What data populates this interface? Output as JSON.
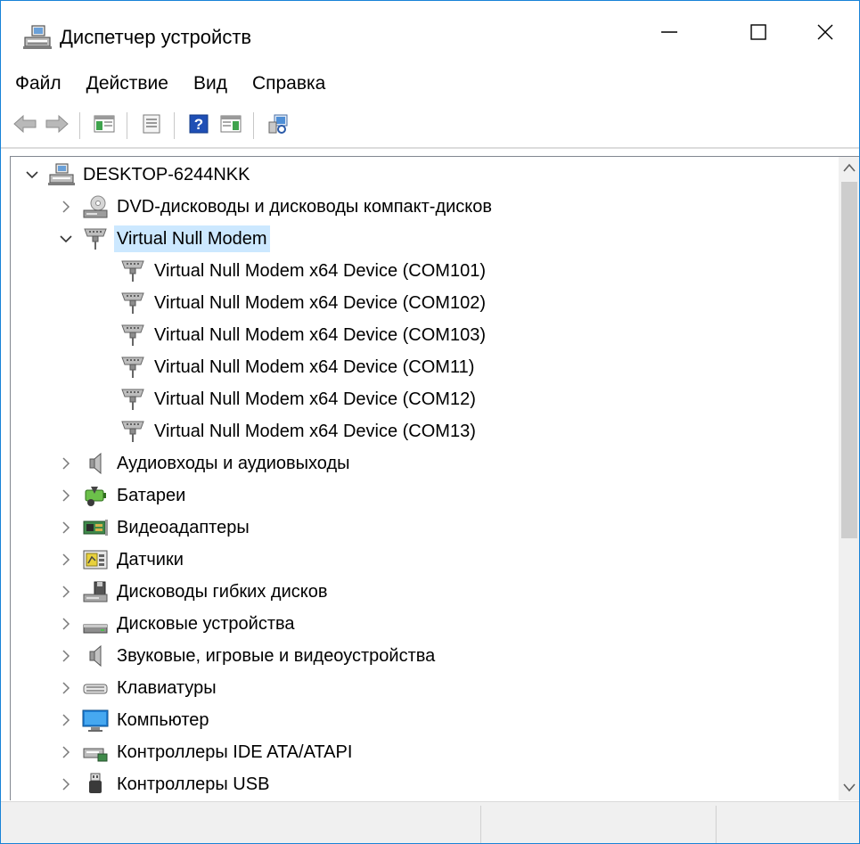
{
  "window": {
    "title": "Диспетчер устройств",
    "title_icon": "device-manager-icon",
    "controls": [
      "minimize-icon",
      "maximize-icon",
      "close-icon"
    ]
  },
  "menu": {
    "items": [
      "Файл",
      "Действие",
      "Вид",
      "Справка"
    ]
  },
  "toolbar": {
    "buttons": [
      "back-arrow-icon",
      "forward-arrow-icon",
      "console-tree-icon",
      "properties-icon",
      "help-icon",
      "action-pane-icon",
      "scan-hardware-icon"
    ]
  },
  "tree": {
    "root": {
      "label": "DESKTOP-6244NKK",
      "expanded": true,
      "icon": "computer-icon"
    },
    "items": [
      {
        "label": "DVD-дисководы и дисководы компакт-дисков",
        "expanded": false,
        "icon": "dvd-drive-icon"
      },
      {
        "label": "Virtual Null Modem",
        "expanded": true,
        "selected": true,
        "icon": "serial-port-icon",
        "children": [
          "Virtual Null Modem x64 Device (COM101)",
          "Virtual Null Modem x64 Device (COM102)",
          "Virtual Null Modem x64 Device (COM103)",
          "Virtual Null Modem x64 Device (COM11)",
          "Virtual Null Modem x64 Device (COM12)",
          "Virtual Null Modem x64 Device (COM13)"
        ]
      },
      {
        "label": "Аудиовходы и аудиовыходы",
        "expanded": false,
        "icon": "speaker-icon"
      },
      {
        "label": "Батареи",
        "expanded": false,
        "icon": "battery-icon"
      },
      {
        "label": "Видеоадаптеры",
        "expanded": false,
        "icon": "display-adapter-icon"
      },
      {
        "label": "Датчики",
        "expanded": false,
        "icon": "sensor-icon"
      },
      {
        "label": "Дисководы гибких дисков",
        "expanded": false,
        "icon": "floppy-drive-icon"
      },
      {
        "label": "Дисковые устройства",
        "expanded": false,
        "icon": "disk-drive-icon"
      },
      {
        "label": "Звуковые, игровые и видеоустройства",
        "expanded": false,
        "icon": "sound-device-icon"
      },
      {
        "label": "Клавиатуры",
        "expanded": false,
        "icon": "keyboard-icon"
      },
      {
        "label": "Компьютер",
        "expanded": false,
        "icon": "monitor-icon"
      },
      {
        "label": "Контроллеры IDE ATA/ATAPI",
        "expanded": false,
        "icon": "ide-controller-icon"
      },
      {
        "label": "Контроллеры USB",
        "expanded": false,
        "icon": "usb-icon"
      }
    ]
  },
  "colors": {
    "selection": "#cce8ff",
    "window_border": "#1883d7"
  }
}
